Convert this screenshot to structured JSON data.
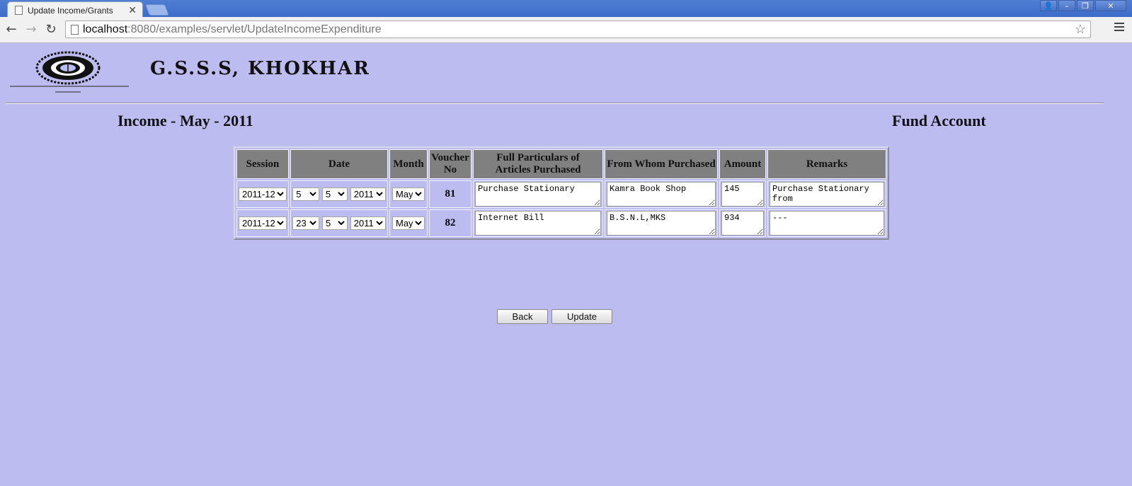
{
  "browser": {
    "tab_title": "Update Income/Grants",
    "tab_close": "✕",
    "url_host": "localhost",
    "url_rest": ":8080/examples/servlet/UpdateIncomeExpenditure",
    "back_icon": "←",
    "forward_icon": "→",
    "reload_icon": "↻",
    "star_icon": "☆",
    "window_buttons": {
      "user": "👤",
      "minimize": "–",
      "restore": "❐",
      "close": "✕"
    }
  },
  "header": {
    "school_name": "G.S.S.S, KHOKHAR"
  },
  "page": {
    "title_left": "Income - May - 2011",
    "title_right": "Fund Account"
  },
  "table": {
    "columns": {
      "session": "Session",
      "date": "Date",
      "month": "Month",
      "voucher_1": "Voucher",
      "voucher_2": "No",
      "particulars_1": "Full Particulars of",
      "particulars_2": "Articles Purchased",
      "from_whom": "From Whom Purchased",
      "amount": "Amount",
      "remarks": "Remarks"
    },
    "rows": [
      {
        "session": "2011-12",
        "day": "5",
        "month_num": "5",
        "year": "2011",
        "month": "May",
        "voucher": "81",
        "particulars": "Purchase Stationary",
        "from_whom": "Kamra Book Shop",
        "amount": "145",
        "remarks": "Purchase Stationary from"
      },
      {
        "session": "2011-12",
        "day": "23",
        "month_num": "5",
        "year": "2011",
        "month": "May",
        "voucher": "82",
        "particulars": "Internet Bill",
        "from_whom": "B.S.N.L,MKS",
        "amount": "934",
        "remarks": "---"
      }
    ]
  },
  "buttons": {
    "back": "Back",
    "update": "Update"
  }
}
